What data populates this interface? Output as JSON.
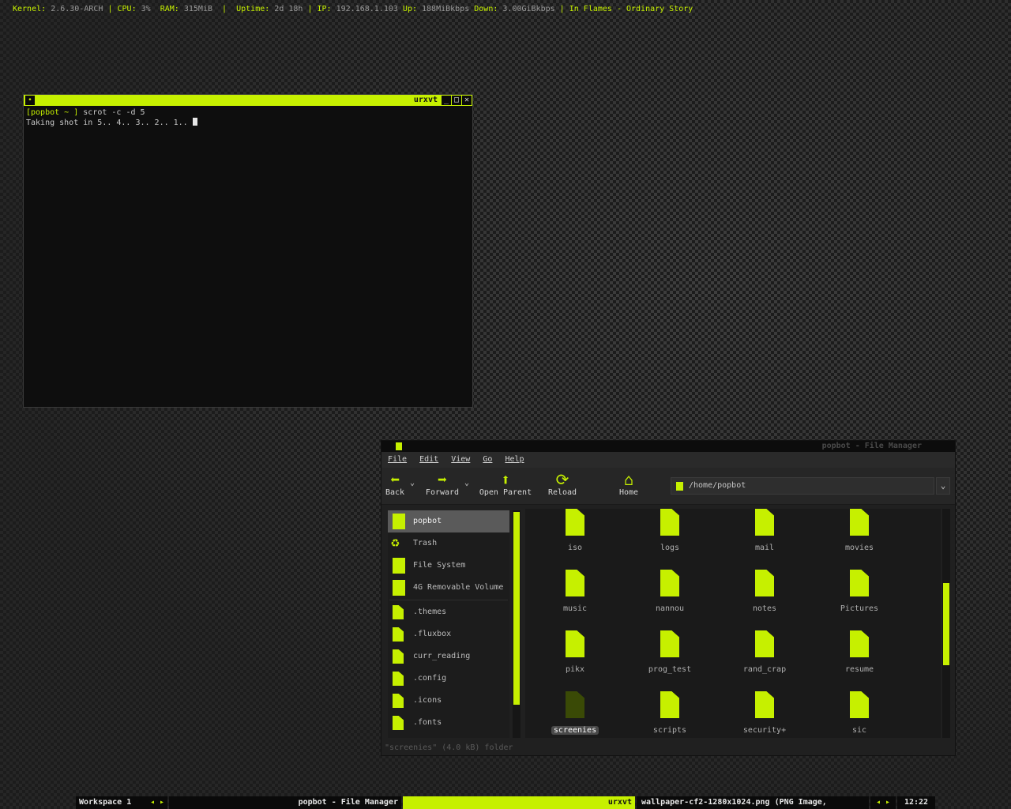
{
  "topbar": {
    "kernel_label": "Kernel:",
    "kernel_value": "2.6.30-ARCH",
    "cpu_label": "CPU:",
    "cpu_value": "3%",
    "ram_label": "RAM:",
    "ram_value": "315MiB",
    "uptime_label": "Uptime:",
    "uptime_value": "2d 18h",
    "ip_label": "IP:",
    "ip_value": "192.168.1.103",
    "up_label": "Up:",
    "up_value": "188MiBkbps",
    "down_label": "Down:",
    "down_value": "3.00GiBkbps",
    "music": "In Flames -  Ordinary Story",
    "sep": "|"
  },
  "terminal": {
    "title": "urxvt",
    "menu_glyph": "•",
    "min_glyph": "_",
    "max_glyph": "□",
    "close_glyph": "✕",
    "prompt": "[popbot ~ ]",
    "command": " scrot -c -d 5",
    "output": "Taking shot in 5.. 4.. 3.. 2.. 1.. "
  },
  "filemanager": {
    "title": "popbot - File Manager",
    "menu": [
      "File",
      "Edit",
      "View",
      "Go",
      "Help"
    ],
    "toolbar": {
      "back": "Back",
      "forward": "Forward",
      "open_parent": "Open Parent",
      "reload": "Reload",
      "home": "Home",
      "back_icon": "arrow-left-icon",
      "forward_icon": "arrow-right-icon",
      "parent_icon": "arrow-up-icon",
      "reload_icon": "reload-icon",
      "home_icon": "home-icon"
    },
    "address": "/home/popbot",
    "sidebar": {
      "places": [
        "popbot",
        "Trash",
        "File System",
        "4G Removable Volume"
      ],
      "bookmarks": [
        ".themes",
        ".fluxbox",
        "curr_reading",
        ".config",
        ".icons",
        ".fonts"
      ]
    },
    "items": [
      "iso",
      "logs",
      "mail",
      "movies",
      "music",
      "nannou",
      "notes",
      "Pictures",
      "pikx",
      "prog_test",
      "rand_crap",
      "resume",
      "screenies",
      "scripts",
      "security+",
      "sic"
    ],
    "selected_item": "screenies",
    "status": "\"screenies\" (4.0 kB) folder",
    "accent": "#c6f000"
  },
  "taskbar": {
    "workspace": "Workspace 1",
    "arrows_left": "◂ ▸",
    "task_fm": "popbot - File Manager",
    "task_term": "urxvt",
    "task_browser": "wallpaper-cf2-1280x1024.png (PNG Image,",
    "arrows_right": "◂ ▸",
    "clock": "12:22"
  }
}
